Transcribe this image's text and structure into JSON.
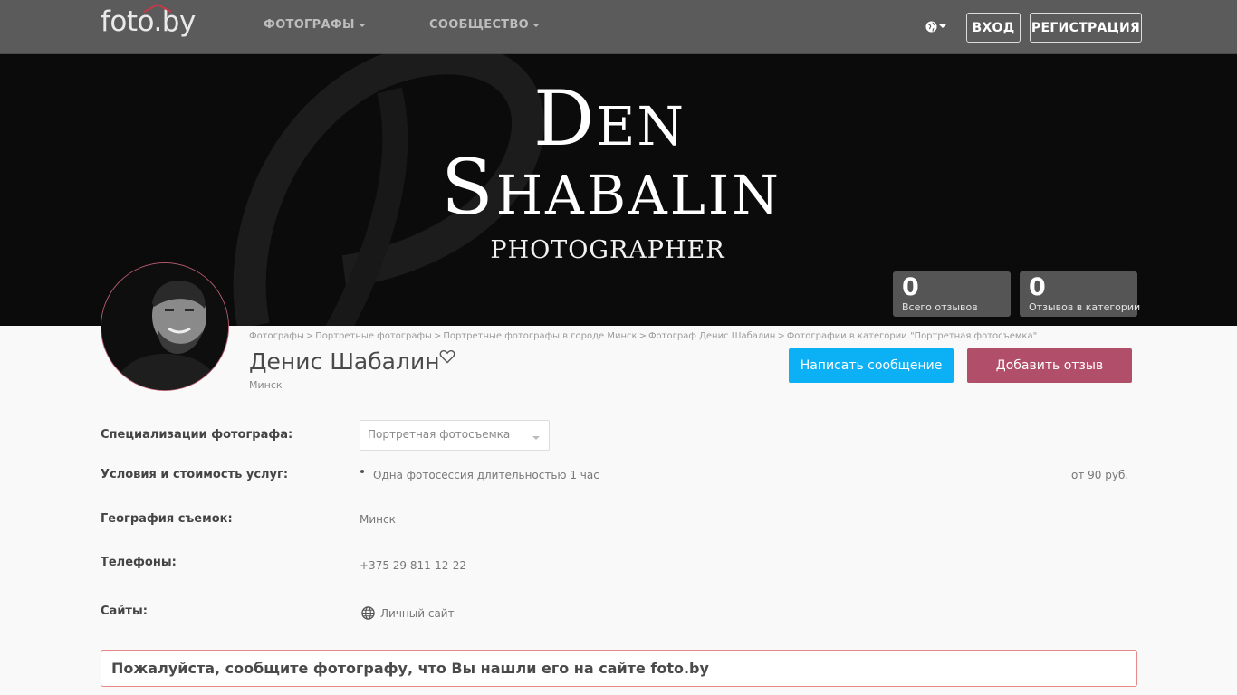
{
  "header": {
    "logo": "foto.by",
    "menu": [
      {
        "label": "ФОТОГРАФЫ"
      },
      {
        "label": "СООБЩЕСТВО"
      }
    ],
    "login_label": "ВХОД",
    "register_label": "РЕГИСТРАЦИЯ"
  },
  "cover": {
    "line1": "Den",
    "line2": "Shabalin",
    "line3": "photographer"
  },
  "stats": [
    {
      "value": "0",
      "label": "Всего отзывов"
    },
    {
      "value": "0",
      "label": "Отзывов в категории"
    }
  ],
  "breadcrumb": [
    "Фотографы",
    "Портретные фотографы",
    "Портретные фотографы в городе Минск",
    "Фотограф Денис Шабалин",
    "Фотографии в категории \"Портретная фотосъемка\""
  ],
  "breadcrumb_separator": ">",
  "profile": {
    "name": "Денис Шабалин",
    "city": "Минск"
  },
  "actions": {
    "message_label": "Написать сообщение",
    "review_label": "Добавить отзыв"
  },
  "details": {
    "specializations_label": "Специализации фотографа:",
    "specialization_selected": "Портретная фотосъемка",
    "services_label": "Условия и стоимость услуг:",
    "service_item": "Одна фотосессия длительностью 1 час",
    "service_price": "от 90 руб.",
    "geography_label": "География съемок:",
    "geography_value": "Минск",
    "phones_label": "Телефоны:",
    "phone_value": "+375 29 811-12-22",
    "sites_label": "Сайты:",
    "site_link": "Личный сайт"
  },
  "notice": "Пожалуйста, сообщите фотографу, что Вы нашли его на сайте foto.by",
  "icons": [
    "globe-icon",
    "heart-icon",
    "chevron-down-icon"
  ],
  "colors": {
    "navbar": "#5b5b5b",
    "message_button": "#0bb0f5",
    "review_button": "#b14e69",
    "notice_border": "#e58a8a"
  }
}
